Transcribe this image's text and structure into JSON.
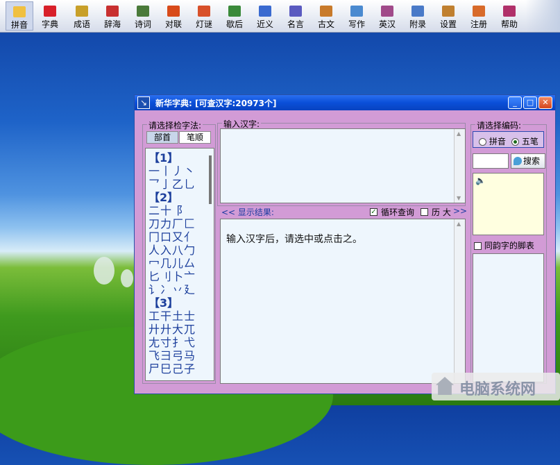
{
  "toolbar": {
    "items": [
      {
        "label": "拼音",
        "icon": "face-icon",
        "color": "#f0c040"
      },
      {
        "label": "字典",
        "icon": "red-book-icon",
        "color": "#d8202a"
      },
      {
        "label": "成语",
        "icon": "books-icon",
        "color": "#c8a02a"
      },
      {
        "label": "辞海",
        "icon": "open-book-icon",
        "color": "#c83030"
      },
      {
        "label": "诗词",
        "icon": "scroll-icon",
        "color": "#4a7a3a"
      },
      {
        "label": "对联",
        "icon": "couplet-icon",
        "color": "#d84a1a"
      },
      {
        "label": "灯谜",
        "icon": "lantern-icon",
        "color": "#d8502a"
      },
      {
        "label": "歇后",
        "icon": "cards-icon",
        "color": "#3a8a3a"
      },
      {
        "label": "近义",
        "icon": "book-blue-icon",
        "color": "#3a6ad0"
      },
      {
        "label": "名言",
        "icon": "notebook-icon",
        "color": "#5a5ac0"
      },
      {
        "label": "古文",
        "icon": "ancient-book-icon",
        "color": "#c87a2a"
      },
      {
        "label": "写作",
        "icon": "pen-icon",
        "color": "#4a8ad0"
      },
      {
        "label": "英汉",
        "icon": "dictionary-icon",
        "color": "#a04a8a"
      },
      {
        "label": "附录",
        "icon": "appendix-icon",
        "color": "#4a7ac8"
      },
      {
        "label": "设置",
        "icon": "gear-icon",
        "color": "#c08030"
      },
      {
        "label": "注册",
        "icon": "door-icon",
        "color": "#d86a2a"
      },
      {
        "label": "帮助",
        "icon": "help-book-icon",
        "color": "#b0306a"
      }
    ]
  },
  "window": {
    "title": "新华字典: [可查汉字:20973个]",
    "minimize": "_",
    "maximize": "□",
    "close": "✕"
  },
  "left": {
    "group_title": "请选择检字法:",
    "tabs": [
      "部首",
      "笔顺"
    ],
    "groups": [
      {
        "header": "【1】",
        "rows": [
          "一丨丿丶",
          "乛亅乙乚"
        ]
      },
      {
        "header": "【2】",
        "rows": [
          "二十 阝",
          "刀力厂匚",
          "冂口又亻",
          "人入八勹",
          "冖几儿厶",
          "匕刂卜亠",
          "讠冫丷廴"
        ]
      },
      {
        "header": "【3】",
        "rows": [
          "工干土士",
          "廾廾大兀",
          "尢寸扌弋",
          "飞彐弓马",
          "尸巳己子"
        ]
      }
    ]
  },
  "input": {
    "group_title": "输入汉字:"
  },
  "result": {
    "label": "<< 显示结果:",
    "loop_query": "循环查询",
    "history": "历 大",
    "history_arrow": ">>",
    "message": "输入汉字后，请选中或点击之。"
  },
  "right": {
    "group_title": "请选择编码:",
    "options": [
      "拼音",
      "五笔"
    ],
    "selected": "五笔",
    "search_button": "搜索",
    "rhyme_label": "同韵字的脚表"
  },
  "watermark": "电脑系统网"
}
